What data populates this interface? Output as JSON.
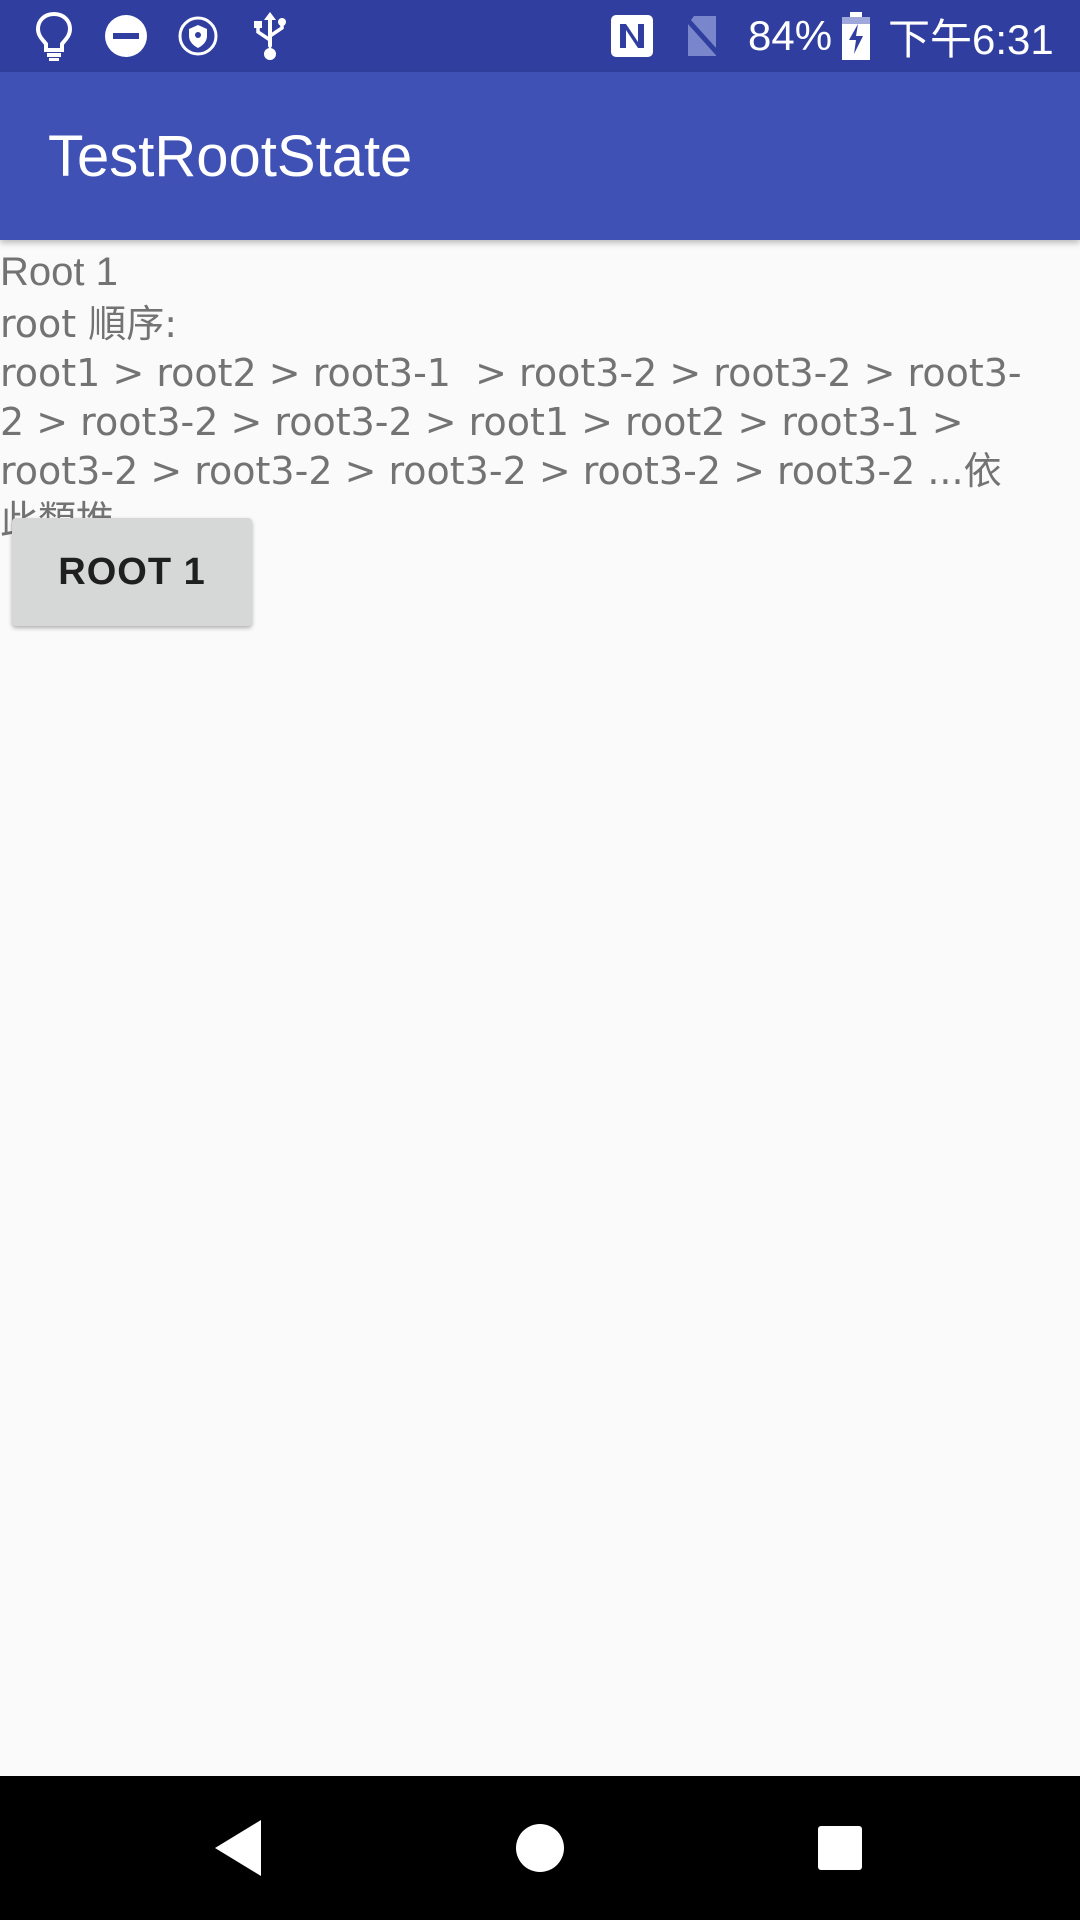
{
  "status_bar": {
    "icons": [
      "lightbulb-icon",
      "do-not-disturb-icon",
      "vpn-shield-icon",
      "usb-icon",
      "nfc-icon",
      "no-sim-icon",
      "battery-charging-icon"
    ],
    "battery_percent": "84%",
    "time": "下午6:31",
    "background": "#303f9f"
  },
  "app_bar": {
    "title": "TestRootState",
    "background": "#3f51b5"
  },
  "main": {
    "root_title": "Root 1",
    "order_text": "root 順序:\nroot1 > root2 > root3-1  > root3-2 > root3-2 > root3-2 > root3-2 > root3-2 > root1 > root2 > root3-1 > root3-2 > root3-2 > root3-2 > root3-2 > root3-2 ...依此類推",
    "button_label": "ROOT 1"
  },
  "nav_bar": {
    "icons": [
      "back-icon",
      "home-icon",
      "recents-icon"
    ]
  }
}
